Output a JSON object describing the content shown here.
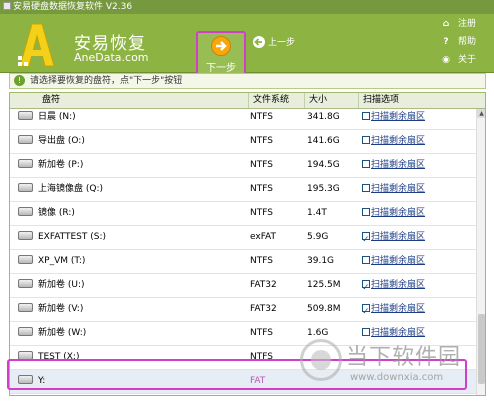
{
  "window": {
    "title": "安易硬盘数据恢复软件 V2.36"
  },
  "brand": {
    "name": "安易恢复",
    "site": "AneData.com"
  },
  "toolbar": {
    "next_label": "下一步",
    "prev_label": "上一步"
  },
  "side_links": [
    {
      "label": "注册",
      "icon": "register-icon"
    },
    {
      "label": "帮助",
      "icon": "help-icon"
    },
    {
      "label": "关于",
      "icon": "about-icon"
    }
  ],
  "notice": {
    "text": "请选择要恢复的盘符，点\"下一步\"按钮"
  },
  "table": {
    "headers": {
      "drive": "盘符",
      "fs": "文件系统",
      "size": "大小",
      "scan": "扫描选项"
    },
    "rows": [
      {
        "name": "日晨 (N:)",
        "fs": "NTFS",
        "size": "341.8G",
        "scan": "扫描剩余扇区",
        "checked": false
      },
      {
        "name": "导出盘 (O:)",
        "fs": "NTFS",
        "size": "141.6G",
        "scan": "扫描剩余扇区",
        "checked": false
      },
      {
        "name": "新加卷 (P:)",
        "fs": "NTFS",
        "size": "194.5G",
        "scan": "扫描剩余扇区",
        "checked": false
      },
      {
        "name": "上海镜像盘 (Q:)",
        "fs": "NTFS",
        "size": "195.3G",
        "scan": "扫描剩余扇区",
        "checked": false
      },
      {
        "name": "镜像 (R:)",
        "fs": "NTFS",
        "size": "1.4T",
        "scan": "扫描剩余扇区",
        "checked": false
      },
      {
        "name": "EXFATTEST (S:)",
        "fs": "exFAT",
        "size": "5.9G",
        "scan": "扫描剩余扇区",
        "checked": true
      },
      {
        "name": "XP_VM (T:)",
        "fs": "NTFS",
        "size": "39.1G",
        "scan": "扫描剩余扇区",
        "checked": false
      },
      {
        "name": "新加卷 (U:)",
        "fs": "FAT32",
        "size": "125.5M",
        "scan": "扫描剩余扇区",
        "checked": true
      },
      {
        "name": "新加卷 (V:)",
        "fs": "FAT32",
        "size": "509.8M",
        "scan": "扫描剩余扇区",
        "checked": true
      },
      {
        "name": "新加卷 (W:)",
        "fs": "NTFS",
        "size": "1.6G",
        "scan": "扫描剩余扇区",
        "checked": false
      },
      {
        "name": "TEST (X:)",
        "fs": "NTFS",
        "size": "",
        "scan": "",
        "checked": false
      },
      {
        "name": "Y:",
        "fs": "FAT",
        "size": "",
        "scan": "",
        "checked": false,
        "selected": true
      }
    ]
  },
  "watermark": {
    "text": "当下软件园",
    "url": "www.downxia.com"
  },
  "colors": {
    "header_green": "#8db442",
    "titlebar_green": "#76983f",
    "highlight_magenta": "#d13ecb",
    "next_orange": "#f7a70b",
    "link_blue": "#1c3d85"
  }
}
